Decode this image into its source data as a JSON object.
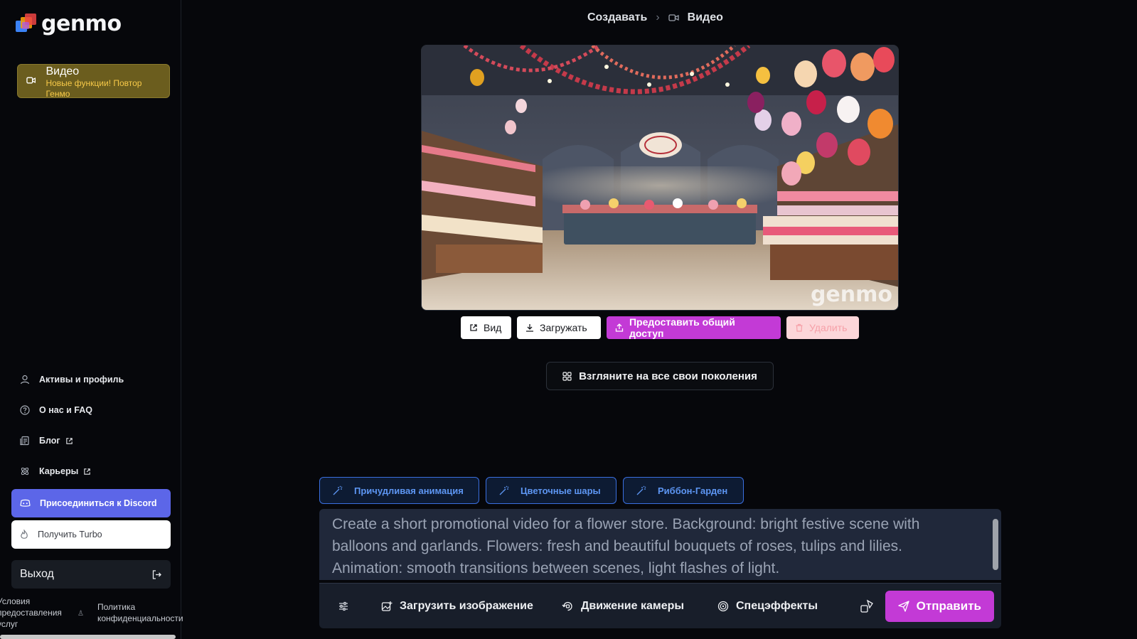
{
  "brand": {
    "name": "genmo"
  },
  "sidebar": {
    "video_card": {
      "title": "Видео",
      "subtitle": "Новые функции! Повтор Генмо"
    },
    "items": [
      {
        "label": "Активы и профиль",
        "icon": "user-icon"
      },
      {
        "label": "О нас и FAQ",
        "icon": "help-circle-icon"
      },
      {
        "label": "Блог",
        "icon": "blog-icon",
        "external": true
      },
      {
        "label": "Карьеры",
        "icon": "atom-icon",
        "external": true
      }
    ],
    "discord_label": "Присоединиться к Discord",
    "turbo_label": "Получить Turbo",
    "logout_label": "Выход",
    "legal": {
      "terms": "Условия предоставления услуг",
      "privacy": "Политика конфиденциальности"
    }
  },
  "breadcrumb": {
    "parent": "Создавать",
    "separator": "›",
    "current": "Видео"
  },
  "preview": {
    "watermark": "genmo"
  },
  "actions": {
    "view": "Вид",
    "download": "Загружать",
    "share": "Предоставить общий доступ",
    "delete": "Удалить"
  },
  "generations_button": "Взгляните на все свои поколения",
  "suggestions": [
    "Причудливая анимация",
    "Цветочные шары",
    "Риббон-Гарден"
  ],
  "prompt": {
    "text": "Create a short promotional video for a flower store. Background: bright festive scene with balloons and garlands. Flowers: fresh and beautiful bouquets of roses, tulips and lilies. Animation: smooth transitions between scenes, light flashes of light."
  },
  "toolbar": {
    "upload_image": "Загрузить изображение",
    "camera_motion": "Движение камеры",
    "effects": "Спецэффекты",
    "send": "Отправить"
  },
  "colors": {
    "accent": "#c33ad6",
    "discord": "#5c66e8",
    "video_card": "#6b5d1e",
    "chip_blue": "#5d96f3"
  }
}
